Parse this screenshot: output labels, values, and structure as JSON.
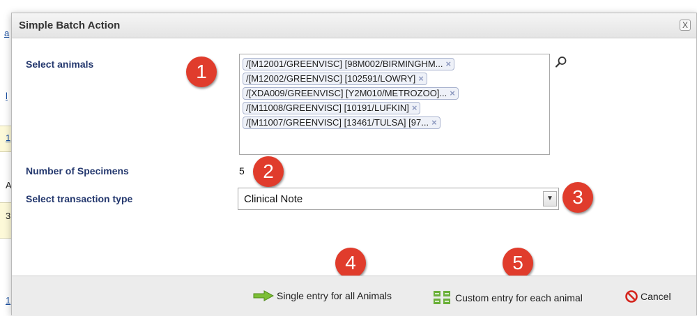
{
  "background": {
    "fragments": [
      "a",
      "l",
      "1",
      "A",
      "3",
      "1"
    ]
  },
  "dialog": {
    "title": "Simple Batch Action",
    "close_label": "X"
  },
  "select_animals": {
    "label": "Select animals",
    "chips": [
      "/[M12001/GREENVISC] [98M002/BIRMINGHM...",
      "/[M12002/GREENVISC] [102591/LOWRY]",
      "/[XDA009/GREENVISC] [Y2M010/METROZOO]...",
      "/[M11008/GREENVISC] [10191/LUFKIN]",
      "/[M11007/GREENVISC] [13461/TULSA] [97..."
    ],
    "remove_glyph": "×"
  },
  "specimens": {
    "label": "Number of Specimens",
    "value": "5"
  },
  "transaction": {
    "label": "Select transaction type",
    "selected": "Clinical Note"
  },
  "badges": [
    "1",
    "2",
    "3",
    "4",
    "5"
  ],
  "footer": {
    "single_entry": "Single entry for all Animals",
    "custom_entry": "Custom entry for each animal",
    "cancel": "Cancel"
  },
  "colors": {
    "label": "#24386e",
    "badge": "#e03c2c",
    "chip_bg": "#eef1f8"
  }
}
